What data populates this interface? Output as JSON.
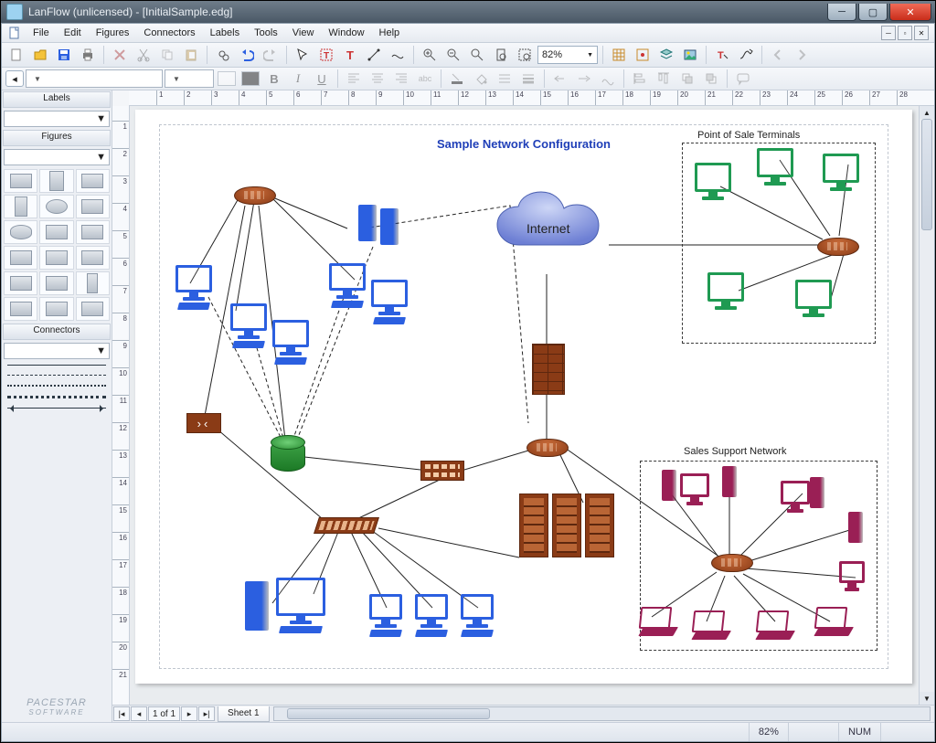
{
  "window": {
    "title": "LanFlow (unlicensed) - [InitialSample.edg]"
  },
  "menus": {
    "file": "File",
    "edit": "Edit",
    "figures": "Figures",
    "connectors": "Connectors",
    "labels": "Labels",
    "tools": "Tools",
    "view": "View",
    "window": "Window",
    "help": "Help"
  },
  "toolbar": {
    "zoom": "82%"
  },
  "sidebar": {
    "labels_panel": "Labels",
    "figures_panel": "Figures",
    "connectors_panel": "Connectors",
    "logo_line1": "PACESTAR",
    "logo_line2": "SOFTWARE"
  },
  "tabs": {
    "page_of": "1 of 1",
    "sheet1": "Sheet 1"
  },
  "status": {
    "zoom": "82%",
    "num": "NUM"
  },
  "diagram": {
    "title": "Sample Network Configuration",
    "group1": "Point of Sale Terminals",
    "group2": "Sales Support Network",
    "cloud": "Internet"
  }
}
